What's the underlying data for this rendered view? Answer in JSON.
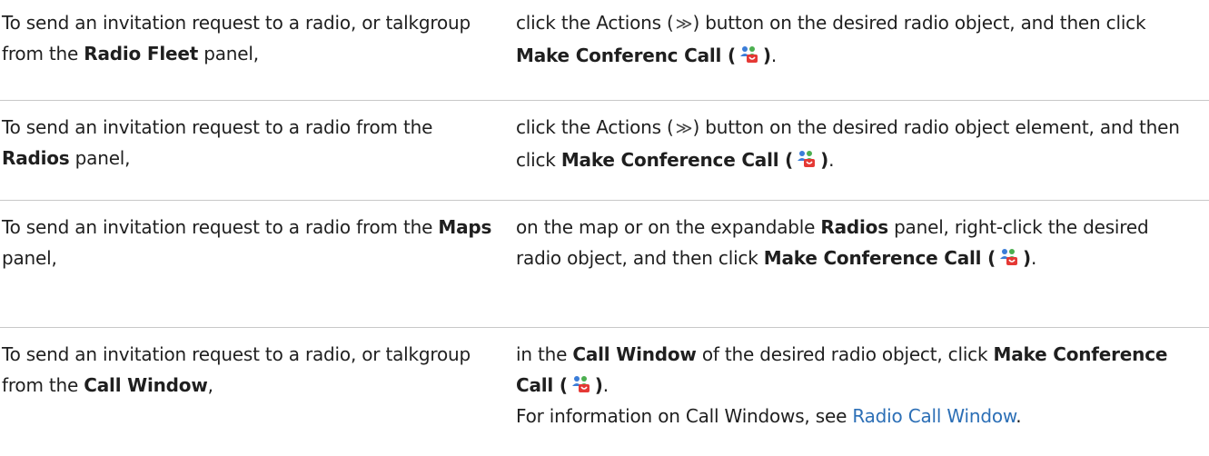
{
  "rows": [
    {
      "left": {
        "pre": "To send an invitation request to a radio, or talkgroup from the ",
        "bold": "Radio Fleet",
        "post": " panel,"
      },
      "right": {
        "p1": "click the Actions (",
        "actions_glyph": "≫",
        "p2": ") button on the desired radio object, and then click ",
        "bold": "Make Conferenc  Call (",
        "bold_close": ")",
        "end": "."
      }
    },
    {
      "left": {
        "pre": "To send an invitation request to a radio from the ",
        "bold": "Radios",
        "post": " panel,"
      },
      "right": {
        "p1": "click the Actions (",
        "actions_glyph": "≫",
        "p2": ") button on the desired radio object element, and then click ",
        "bold": "Make Conference Call (",
        "bold_close": ")",
        "end": "."
      }
    },
    {
      "left": {
        "pre": "To send an invitation request to a radio from the ",
        "bold": "Maps",
        "post": " panel,"
      },
      "right": {
        "p1": "on the map or on the expandable ",
        "bold1": "Radios",
        "p2": " panel, right-click the desired radio object, and then click ",
        "bold": "Make Conference Call (",
        "bold_close": ")",
        "end": "."
      }
    },
    {
      "left": {
        "pre": "To send an invitation request to a radio, or talkgroup from the ",
        "bold": "Call Window",
        "post": ","
      },
      "right": {
        "p1": "in the ",
        "bold1": "Call Window",
        "p2": " of the desired radio object, click ",
        "bold": "Make Conference Call (",
        "bold_close": ")",
        "end": ".",
        "info_pre": "For information on Call Windows, see ",
        "info_link": "Radio Call Window",
        "info_end": "."
      }
    }
  ],
  "icon": "conference-call-icon",
  "colors": {
    "link": "#2c6fb6",
    "divider": "#c8c8c8",
    "text": "#1f1f1f"
  }
}
